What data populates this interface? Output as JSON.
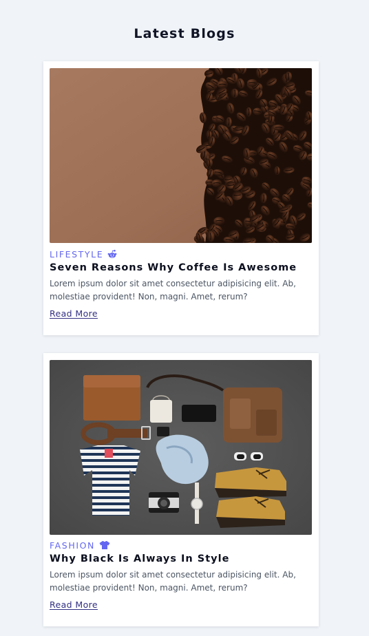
{
  "page": {
    "title": "Latest Blogs"
  },
  "posts": [
    {
      "category": "LIFESTYLE",
      "category_icon": "reddit-robot-icon",
      "title": "Seven Reasons Why Coffee Is Awesome",
      "excerpt": "Lorem ipsum dolor sit amet consectetur adipisicing elit. Ab, molestiae provident! Non, magni. Amet, rerum?",
      "link_label": "Read More",
      "image": "coffee-beans-photo"
    },
    {
      "category": "FASHION",
      "category_icon": "tshirt-icon",
      "title": "Why Black Is Always In Style",
      "excerpt": "Lorem ipsum dolor sit amet consectetur adipisicing elit. Ab, molestiae provident! Non, magni. Amet, rerum?",
      "link_label": "Read More",
      "image": "flatlay-accessories-photo"
    }
  ],
  "colors": {
    "background": "#f0f4f8",
    "accent": "#6366f1",
    "link": "#312e81"
  }
}
